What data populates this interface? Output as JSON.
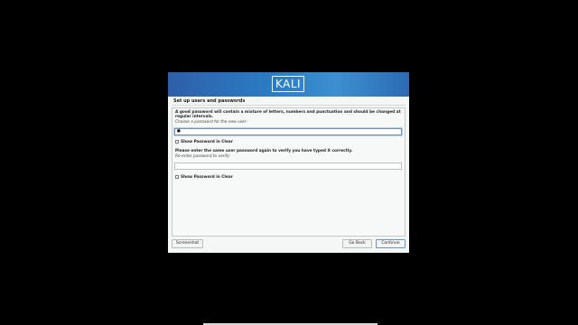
{
  "banner": {
    "logo_text": "KALI"
  },
  "page": {
    "title": "Set up users and passwords"
  },
  "panel": {
    "intro_line1": "A good password will contain a mixture of letters, numbers and punctuation and should be changed at",
    "intro_line2": "regular intervals.",
    "choose_label": "Choose a password for the new user:",
    "password_value": "●",
    "show_password_1": "Show Password in Clear",
    "reenter_intro": "Please enter the same user password again to verify you have typed it correctly.",
    "reenter_label": "Re-enter password to verify:",
    "reenter_value": "",
    "show_password_2": "Show Password in Clear"
  },
  "buttons": {
    "screenshot": "Screenshot",
    "go_back": "Go Back",
    "continue": "Continue"
  },
  "colors": {
    "banner_start": "#2f5fa8",
    "banner_end": "#3d8fcf",
    "focus": "#6f92c4"
  }
}
